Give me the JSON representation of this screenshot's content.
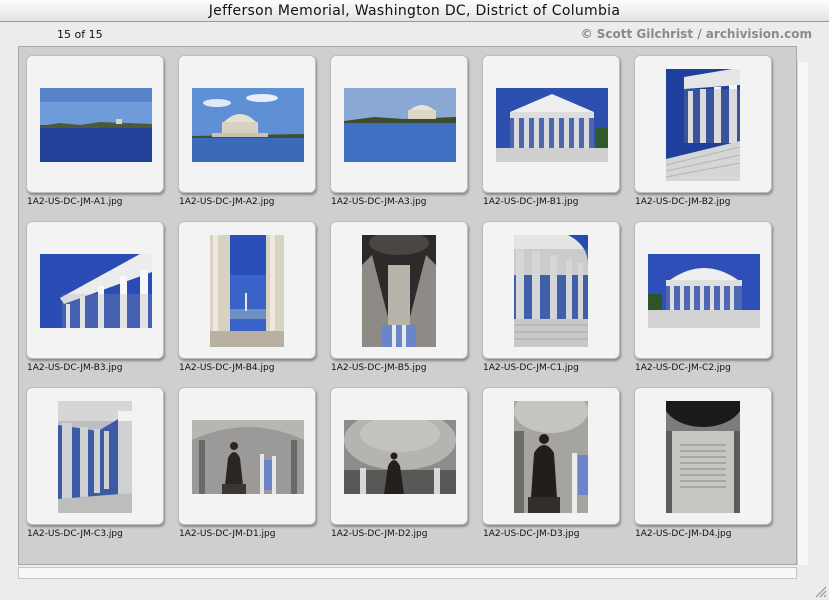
{
  "window": {
    "title": "Jefferson Memorial, Washington DC, District of Columbia"
  },
  "header": {
    "counter": "15 of 15",
    "credit": "© Scott Gilchrist / archivision.com"
  },
  "thumbnails": [
    {
      "filename": "1A2-US-DC-JM-A1.jpg",
      "orientation": "landscape",
      "scene": "tidal-basin-distant"
    },
    {
      "filename": "1A2-US-DC-JM-A2.jpg",
      "orientation": "landscape",
      "scene": "memorial-across-water"
    },
    {
      "filename": "1A2-US-DC-JM-A3.jpg",
      "orientation": "landscape",
      "scene": "memorial-across-water-wide"
    },
    {
      "filename": "1A2-US-DC-JM-B1.jpg",
      "orientation": "landscape",
      "scene": "portico-front"
    },
    {
      "filename": "1A2-US-DC-JM-B2.jpg",
      "orientation": "portrait",
      "scene": "portico-steps"
    },
    {
      "filename": "1A2-US-DC-JM-B3.jpg",
      "orientation": "landscape",
      "scene": "portico-angled"
    },
    {
      "filename": "1A2-US-DC-JM-B4.jpg",
      "orientation": "portrait",
      "scene": "columns-view-monument"
    },
    {
      "filename": "1A2-US-DC-JM-B5.jpg",
      "orientation": "portrait",
      "scene": "interior-looking-up"
    },
    {
      "filename": "1A2-US-DC-JM-C1.jpg",
      "orientation": "portrait",
      "scene": "colonnade-side"
    },
    {
      "filename": "1A2-US-DC-JM-C2.jpg",
      "orientation": "landscape",
      "scene": "rotunda-exterior"
    },
    {
      "filename": "1A2-US-DC-JM-C3.jpg",
      "orientation": "portrait",
      "scene": "colonnade-perspective"
    },
    {
      "filename": "1A2-US-DC-JM-D1.jpg",
      "orientation": "landscape",
      "scene": "interior-statue"
    },
    {
      "filename": "1A2-US-DC-JM-D2.jpg",
      "orientation": "landscape",
      "scene": "interior-dome-statue"
    },
    {
      "filename": "1A2-US-DC-JM-D3.jpg",
      "orientation": "portrait",
      "scene": "statue-dome"
    },
    {
      "filename": "1A2-US-DC-JM-D4.jpg",
      "orientation": "portrait",
      "scene": "interior-inscription-wall"
    }
  ]
}
